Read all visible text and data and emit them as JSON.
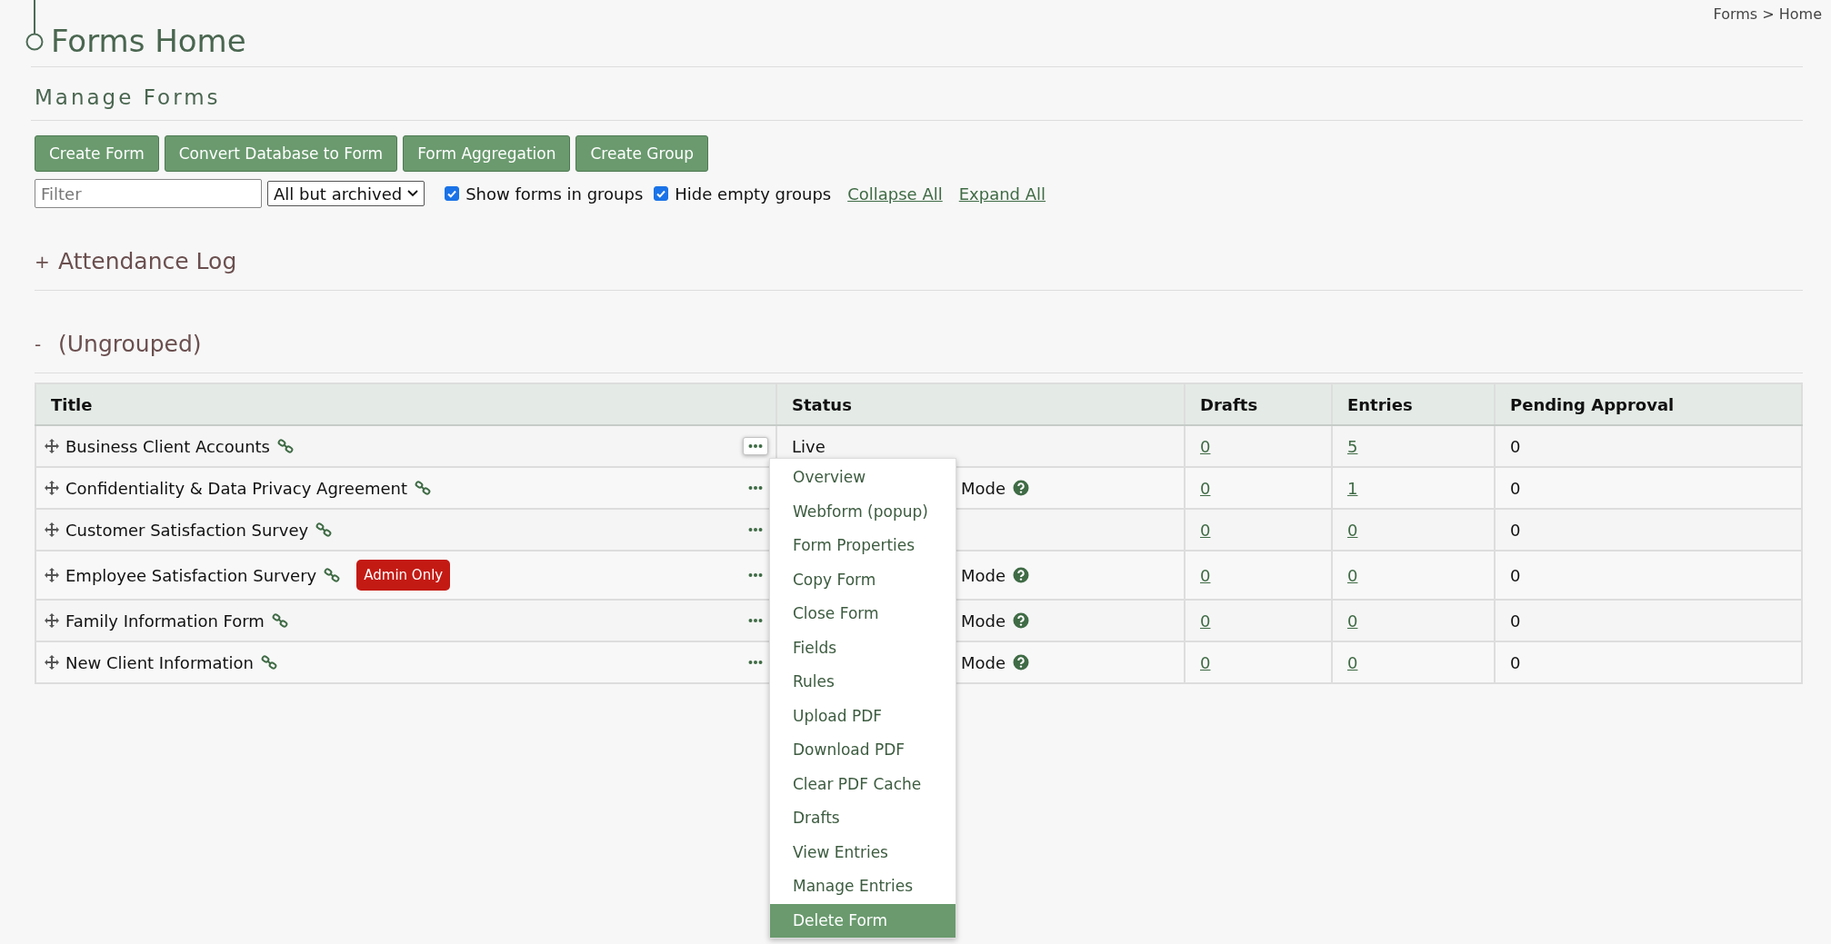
{
  "breadcrumb": "Forms > Home",
  "page_title": "Forms Home",
  "section_title": "Manage Forms",
  "buttons": [
    "Create Form",
    "Convert Database to Form",
    "Form Aggregation",
    "Create Group"
  ],
  "filter": {
    "placeholder": "Filter"
  },
  "archive_select": {
    "value": "All but archived"
  },
  "checkboxes": [
    {
      "label": "Show forms in groups",
      "checked": true
    },
    {
      "label": "Hide empty groups",
      "checked": true
    }
  ],
  "links": [
    "Collapse All",
    "Expand All"
  ],
  "groups": [
    {
      "sign": "+",
      "name": "Attendance Log"
    },
    {
      "sign": "-",
      "name": "(Ungrouped)"
    }
  ],
  "table": {
    "columns": [
      "Title",
      "Status",
      "Drafts",
      "Entries",
      "Pending Approval"
    ],
    "rows": [
      {
        "title": "Business Client Accounts",
        "badge": null,
        "menu_open": true,
        "status": {
          "kind": "plain",
          "text": "Live",
          "help": false
        },
        "drafts": "0",
        "entries": "5",
        "pending": "0"
      },
      {
        "title": "Confidentiality & Data Privacy Agreement",
        "badge": null,
        "menu_open": false,
        "status": {
          "kind": "covered",
          "text": "Mode",
          "help": true
        },
        "drafts": "0",
        "entries": "1",
        "pending": "0"
      },
      {
        "title": "Customer Satisfaction Survey",
        "badge": null,
        "menu_open": false,
        "status": null,
        "drafts": "0",
        "entries": "0",
        "pending": "0"
      },
      {
        "title": "Employee Satisfaction Survery",
        "badge": "Admin Only",
        "menu_open": false,
        "status": {
          "kind": "covered",
          "text": "Mode",
          "help": true
        },
        "drafts": "0",
        "entries": "0",
        "pending": "0"
      },
      {
        "title": "Family Information Form",
        "badge": null,
        "menu_open": false,
        "status": {
          "kind": "covered",
          "text": "Mode",
          "help": true
        },
        "drafts": "0",
        "entries": "0",
        "pending": "0"
      },
      {
        "title": "New Client Information",
        "badge": null,
        "menu_open": false,
        "status": {
          "kind": "covered",
          "text": "Mode",
          "help": true
        },
        "drafts": "0",
        "entries": "0",
        "pending": "0"
      }
    ]
  },
  "row_menu": [
    {
      "label": "Overview",
      "selected": false
    },
    {
      "label": "Webform (popup)",
      "selected": false
    },
    {
      "label": "Form Properties",
      "selected": false
    },
    {
      "label": "Copy Form",
      "selected": false
    },
    {
      "label": "Close Form",
      "selected": false
    },
    {
      "label": "Fields",
      "selected": false
    },
    {
      "label": "Rules",
      "selected": false
    },
    {
      "label": "Upload PDF",
      "selected": false
    },
    {
      "label": "Download PDF",
      "selected": false
    },
    {
      "label": "Clear PDF Cache",
      "selected": false
    },
    {
      "label": "Drafts",
      "selected": false
    },
    {
      "label": "View Entries",
      "selected": false
    },
    {
      "label": "Manage Entries",
      "selected": false
    },
    {
      "label": "Delete Form",
      "selected": true
    }
  ]
}
